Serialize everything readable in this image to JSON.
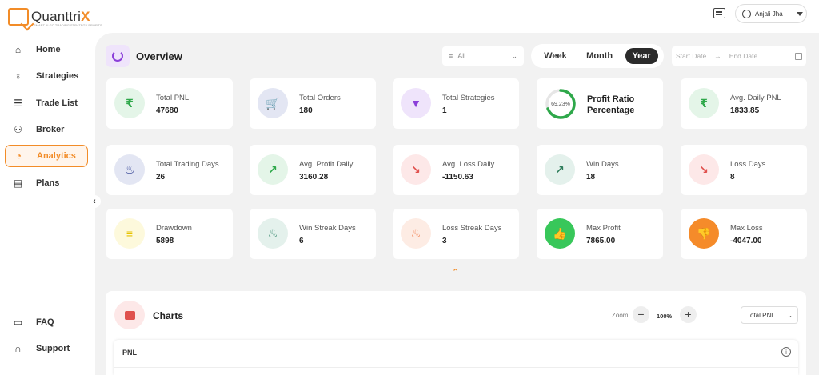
{
  "app": {
    "brand_pre": "Quanttri",
    "brand_post": "X",
    "tagline": "SMART ALGO TRADING STRATEGY PROFITS"
  },
  "header": {
    "user_name": "Anjali Jha"
  },
  "sidebar": {
    "items": [
      {
        "label": "Home",
        "icon": "home-icon"
      },
      {
        "label": "Strategies",
        "icon": "bulb-icon"
      },
      {
        "label": "Trade List",
        "icon": "list-icon"
      },
      {
        "label": "Broker",
        "icon": "network-icon"
      },
      {
        "label": "Analytics",
        "icon": "chart-pie-icon",
        "active": true
      },
      {
        "label": "Plans",
        "icon": "plans-icon"
      }
    ],
    "bottom_items": [
      {
        "label": "FAQ",
        "icon": "faq-icon"
      },
      {
        "label": "Support",
        "icon": "headset-icon"
      }
    ]
  },
  "overview": {
    "title": "Overview",
    "filter_value": "All..",
    "periods": [
      "Week",
      "Month",
      "Year"
    ],
    "selected_period": "Year",
    "start_placeholder": "Start Date",
    "end_placeholder": "End Date"
  },
  "cards": [
    {
      "label": "Total PNL",
      "value": "47680",
      "icon": "rupee-icon",
      "color": "#2ea84a",
      "bg": "#e4f5e8"
    },
    {
      "label": "Total Orders",
      "value": "180",
      "icon": "cart-icon",
      "color": "#2a3a8f",
      "bg": "#e3e6f3"
    },
    {
      "label": "Total Strategies",
      "value": "1",
      "icon": "strategy-icon",
      "color": "#8b3fd9",
      "bg": "#efe4fb"
    },
    {
      "label": "Avg. Daily PNL",
      "value": "1833.85",
      "icon": "rupee-icon",
      "color": "#2ea84a",
      "bg": "#e4f5e8"
    },
    {
      "label": "Total Trading Days",
      "value": "26",
      "icon": "flame-icon",
      "color": "#2a3a8f",
      "bg": "#e3e6f3"
    },
    {
      "label": "Avg. Profit Daily",
      "value": "3160.28",
      "icon": "trend-up-icon",
      "color": "#2ea84a",
      "bg": "#e4f5e8"
    },
    {
      "label": "Avg. Loss Daily",
      "value": "-1150.63",
      "icon": "trend-down-icon",
      "color": "#e0504d",
      "bg": "#fde8e8"
    },
    {
      "label": "Win Days",
      "value": "18",
      "icon": "trend-up-icon",
      "color": "#2e7d5b",
      "bg": "#e4f1ec"
    },
    {
      "label": "Loss Days",
      "value": "8",
      "icon": "trend-down-icon",
      "color": "#e0504d",
      "bg": "#fde8e8"
    },
    {
      "label": "Drawdown",
      "value": "5898",
      "icon": "drawdown-icon",
      "color": "#e6c200",
      "bg": "#fdf9dc"
    },
    {
      "label": "Win Streak Days",
      "value": "6",
      "icon": "flame-icon",
      "color": "#1f7a5c",
      "bg": "#e4f1ec"
    },
    {
      "label": "Loss Streak Days",
      "value": "3",
      "icon": "flame-icon",
      "color": "#f0703c",
      "bg": "#fdece4"
    },
    {
      "label": "Max Profit",
      "value": "7865.00",
      "icon": "thumbs-up-icon",
      "color": "#ffffff",
      "bg": "#38c75a"
    },
    {
      "label": "Max Loss",
      "value": "-4047.00",
      "icon": "thumbs-down-icon",
      "color": "#ffffff",
      "bg": "#f58b2a"
    }
  ],
  "profit_ratio": {
    "title": "Profit Ratio Percentage",
    "value_text": "69.23%",
    "fraction": 0.6923
  },
  "charts": {
    "title": "Charts",
    "zoom_label": "Zoom",
    "zoom_value": "100%",
    "selected": "Total PNL",
    "panel_title": "PNL"
  },
  "colors": {
    "accent": "#f28c28",
    "main_bg": "#f2f2f2",
    "dark_pill": "#2b2b2b"
  }
}
